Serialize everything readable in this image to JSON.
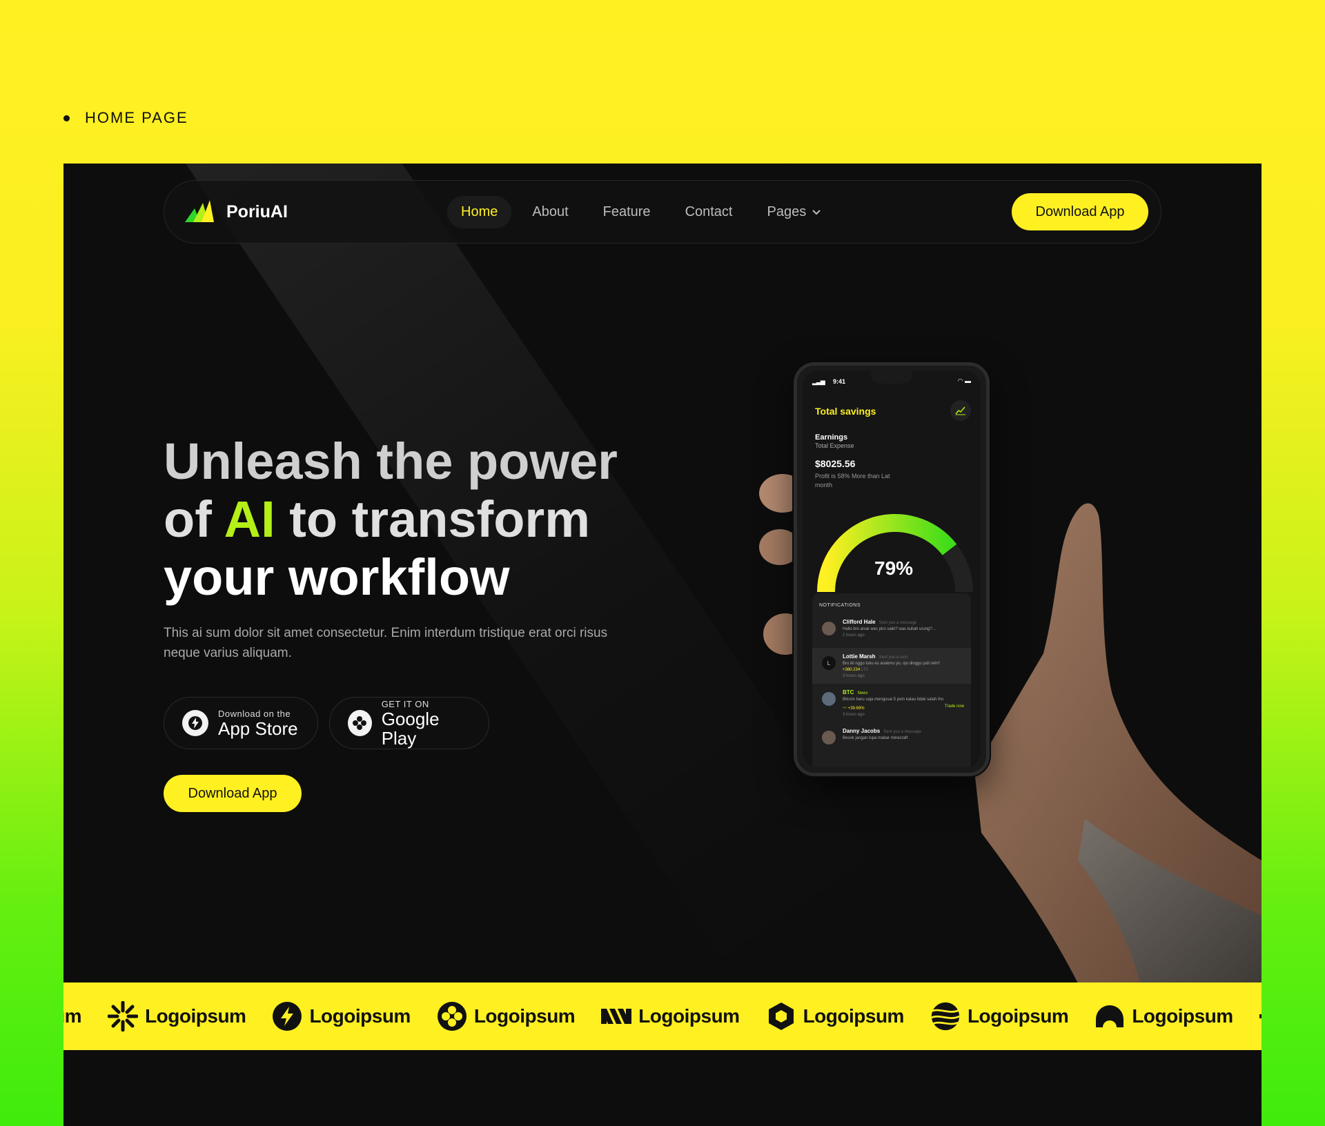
{
  "section_label": "HOME PAGE",
  "nav": {
    "brand": "PoriuAI",
    "links": [
      "Home",
      "About",
      "Feature",
      "Contact",
      "Pages"
    ],
    "cta": "Download App"
  },
  "hero": {
    "title_l1": "Unleash the power",
    "title_l2_a": "of ",
    "title_l2_hl": "AI",
    "title_l2_b": " to transform",
    "title_l3": "your workflow",
    "description": "This ai sum dolor sit amet consectetur. Enim interdum tristique erat orci risus neque varius aliquam.",
    "app_store_small": "Download on the",
    "app_store_big": "App Store",
    "play_small": "GET IT ON",
    "play_big": "Google Play",
    "cta": "Download App"
  },
  "phone": {
    "time": "9:41",
    "title": "Total savings",
    "earnings": "Earnings",
    "expense": "Total Expense",
    "amount": "$8025.56",
    "profit": "Profit is 58% More than Lat month",
    "gauge_percent": "79%",
    "gauge_value": 0.79,
    "notifications_label": "NOTIFICATIONS",
    "notifications": [
      {
        "name": "Clifford Hale",
        "meta": "Sent you a message",
        "text": "Hallo bro anak wes piro saiki? was kuliah urung?...",
        "time": "2 hours ago"
      },
      {
        "name": "Lottie Marsh",
        "meta": "Sent you a coin",
        "text": "Bro iki nggo tuku es anakmu yo, ojo dinggo judi neh!!",
        "value": "+380.234",
        "unit": "LTC",
        "time": "3 hours ago"
      },
      {
        "name": "BTC",
        "meta": "News",
        "text": "Bitcoin baru saja mengusai 5 poin kalau tidak salah iho",
        "change": "+39.69%",
        "action": "Trade now",
        "time": "3 hours ago"
      },
      {
        "name": "Danny Jacobs",
        "meta": "Sent you a message",
        "text": "Besok jangan lupa mabar minecraft"
      }
    ]
  },
  "logos": [
    "sum",
    "Logoipsum",
    "Logoipsum",
    "Logoipsum",
    "Logoipsum",
    "Logoipsum",
    "Logoipsum",
    "Logoipsum"
  ],
  "colors": {
    "accent": "#fff022",
    "highlight": "#b4ef17",
    "background": "#0d0d0d"
  }
}
